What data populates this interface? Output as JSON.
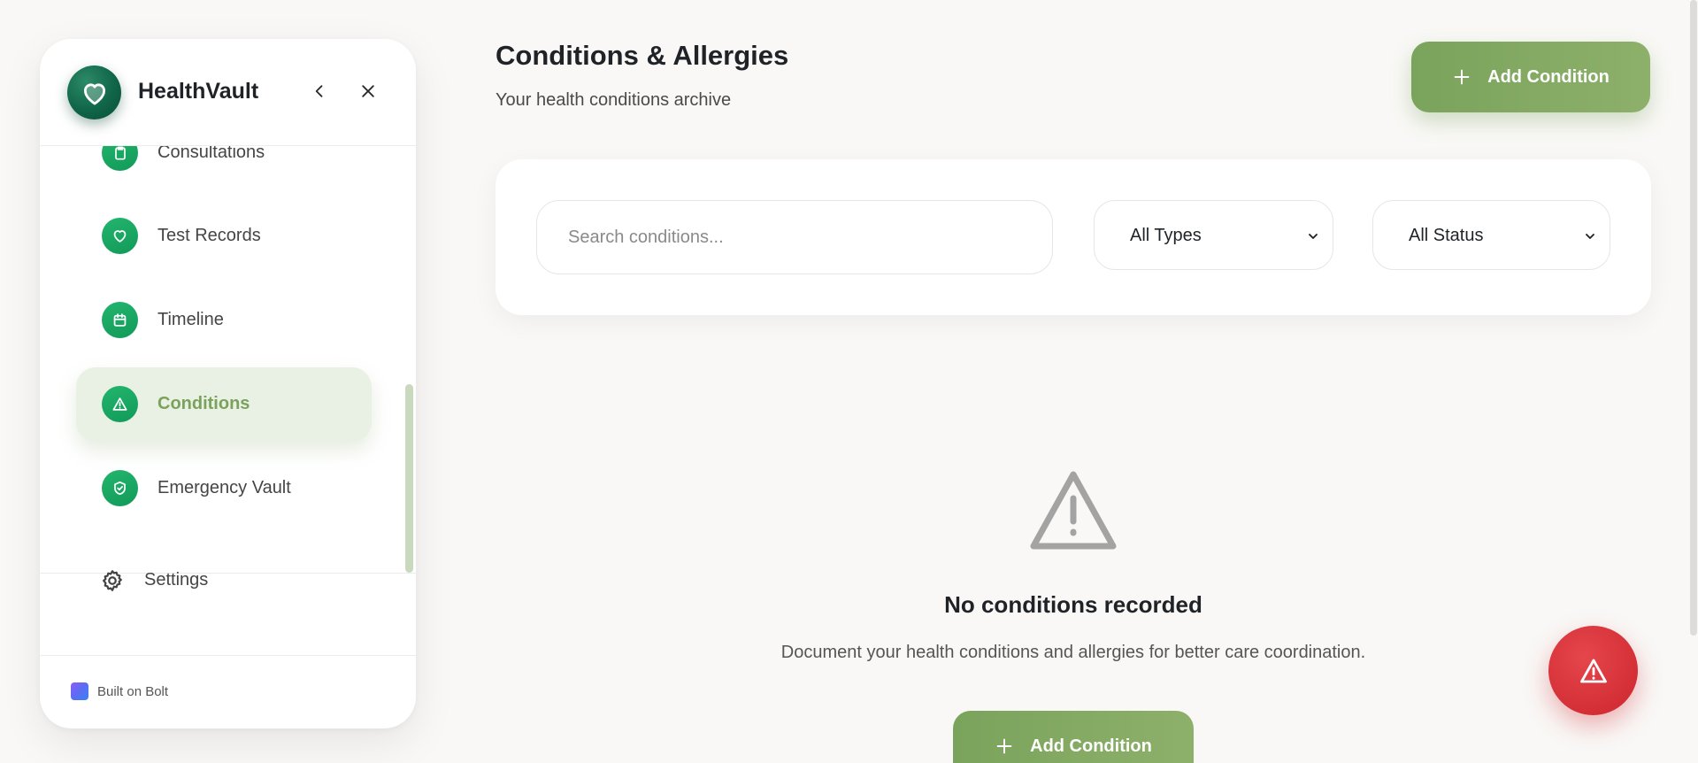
{
  "app": {
    "name": "HealthVault"
  },
  "sidebar": {
    "nav": [
      {
        "label": "Consultations",
        "icon": "clipboard-icon",
        "active": false
      },
      {
        "label": "Test Records",
        "icon": "heart-icon",
        "active": false
      },
      {
        "label": "Timeline",
        "icon": "calendar-icon",
        "active": false
      },
      {
        "label": "Conditions",
        "icon": "warning-icon",
        "active": true
      },
      {
        "label": "Emergency Vault",
        "icon": "shield-icon",
        "active": false
      }
    ],
    "settings_label": "Settings",
    "footer_label": "Built on Bolt"
  },
  "header": {
    "title": "Conditions & Allergies",
    "subtitle": "Your health conditions archive",
    "add_button_label": "Add Condition"
  },
  "filters": {
    "search_placeholder": "Search conditions...",
    "type_selected": "All Types",
    "status_selected": "All Status"
  },
  "empty_state": {
    "title": "No conditions recorded",
    "description": "Document your health conditions and allergies for better care coordination.",
    "button_label": "Add Condition"
  },
  "colors": {
    "accent_green": "#7aa35c",
    "nav_icon_green": "#1aa864",
    "danger_red": "#d42f36",
    "active_bg": "#e9f1e4"
  }
}
